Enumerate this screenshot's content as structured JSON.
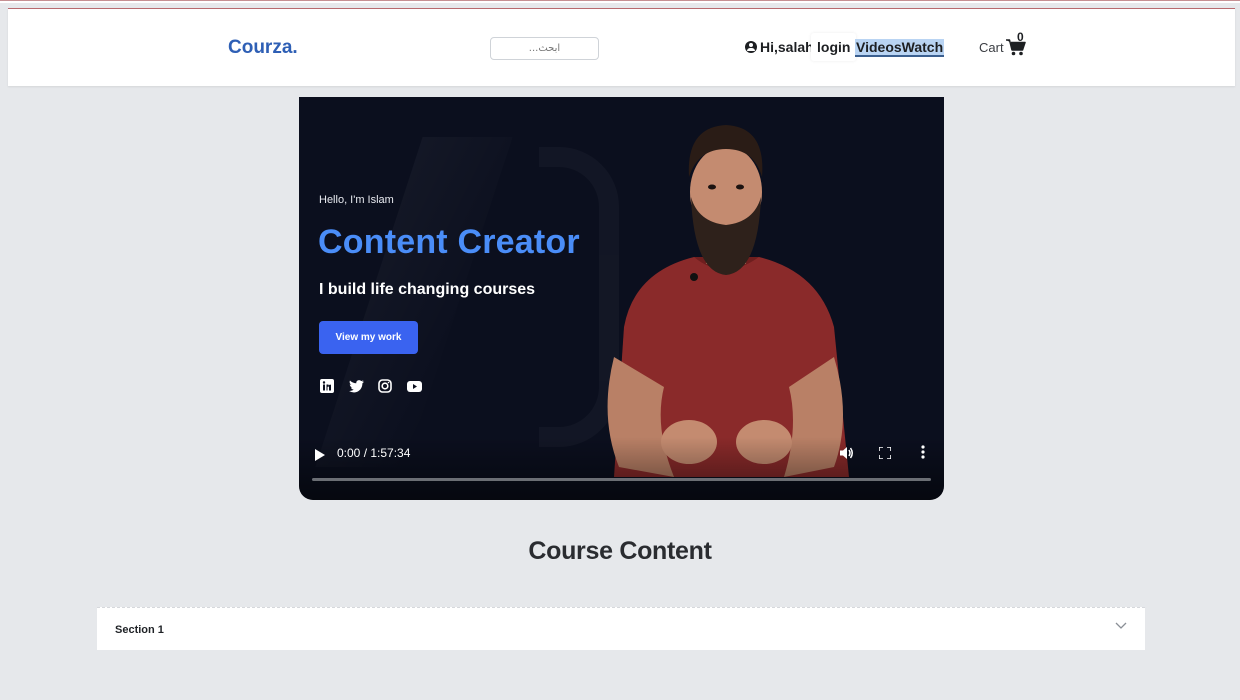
{
  "navbar": {
    "brand": "Courza.",
    "search_placeholder": "...ابحث",
    "user_greeting": "Hi,salah",
    "login_label": "login",
    "videos_label": "VideosWatch",
    "cart_label": "Cart",
    "cart_count": "0"
  },
  "video": {
    "hello": "Hello, I'm Islam",
    "title": "Content Creator",
    "subtitle": "I build life changing courses",
    "cta": "View my work",
    "socials": [
      "linkedin-icon",
      "twitter-icon",
      "instagram-icon",
      "youtube-icon"
    ],
    "time": "0:00 / 1:57:34",
    "progress": 0
  },
  "course": {
    "heading": "Course Content",
    "sections": [
      {
        "label": "Section 1"
      }
    ]
  },
  "colors": {
    "brand": "#2e5fb5",
    "accent_blue": "#4a8df8",
    "cta": "#3a63f0",
    "page_bg": "#e6e8eb"
  }
}
